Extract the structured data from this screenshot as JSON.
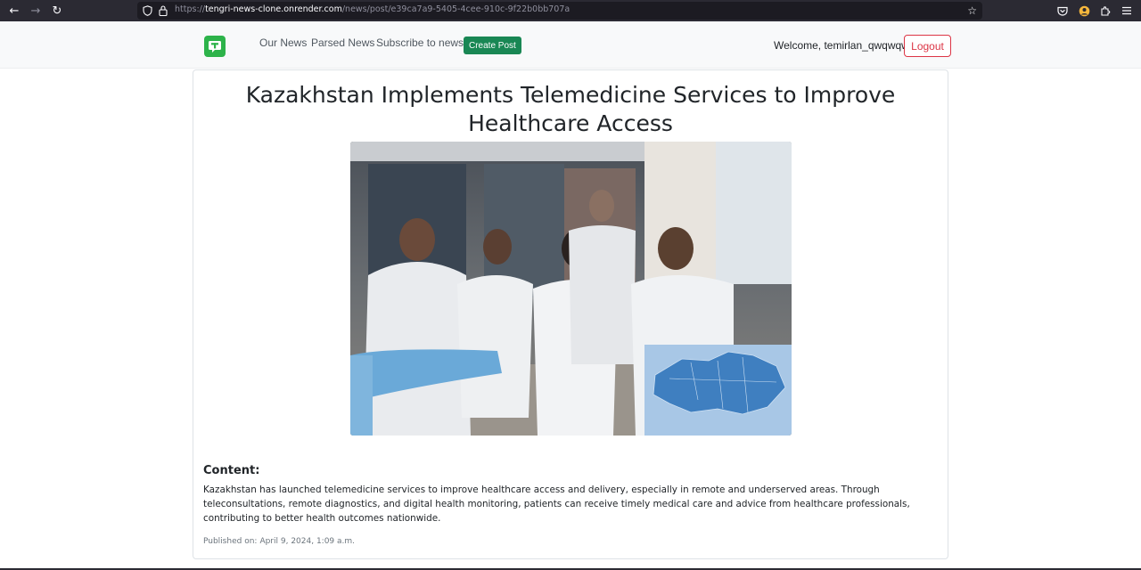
{
  "browser": {
    "url_prefix": "https://",
    "url_host": "tengri-news-clone.onrender.com",
    "url_path": "/news/post/e39ca7a9-5405-4cee-910c-9f22b0bb707a"
  },
  "navbar": {
    "links": [
      "Our News",
      "Parsed News",
      "Subscribe to news"
    ],
    "create_label": "Create Post",
    "welcome_text": "Welcome, temirlan_qwqwqw",
    "logout_label": "Logout",
    "colors": {
      "create": "#198754",
      "logout": "#dc3545",
      "logo": "#2db34a"
    }
  },
  "post": {
    "title": "Kazakhstan Implements Telemedicine Services to Improve Healthcare Access",
    "content_label": "Content:",
    "content": "Kazakhstan has launched telemedicine services to improve healthcare access and delivery, especially in remote and underserved areas. Through teleconsultations, remote diagnostics, and digital health monitoring, patients can receive timely medical care and advice from healthcare professionals, contributing to better health outcomes nationwide.",
    "published_label": "Published on:",
    "published_date": "April 9, 2024, 1:09 a.m."
  }
}
